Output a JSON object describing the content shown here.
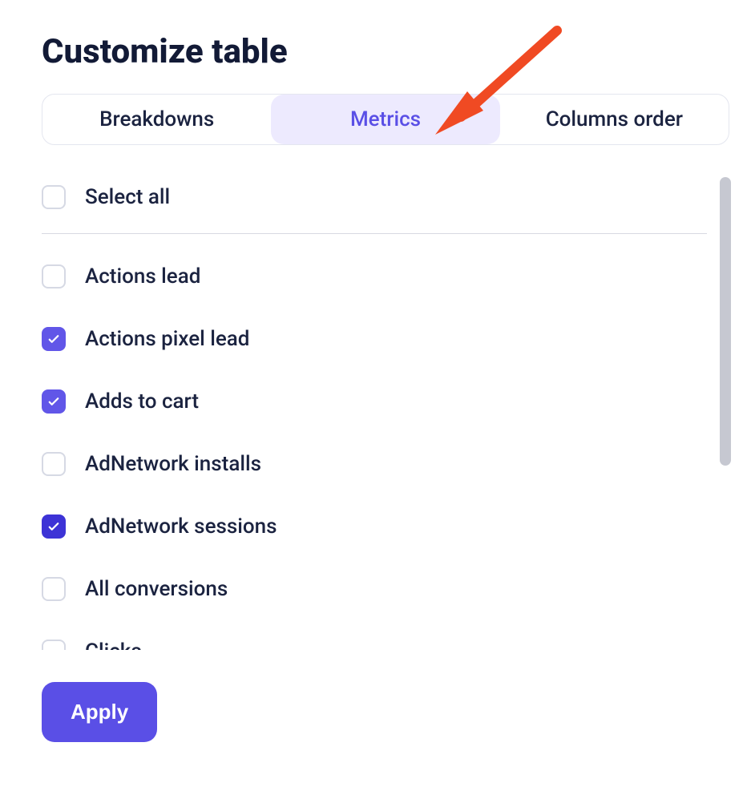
{
  "title": "Customize table",
  "tabs": {
    "breakdowns": "Breakdowns",
    "metrics": "Metrics",
    "columns_order": "Columns order",
    "active": "metrics"
  },
  "select_all": {
    "label": "Select all",
    "checked": false
  },
  "metrics": [
    {
      "label": "Actions lead",
      "checked": false
    },
    {
      "label": "Actions pixel lead",
      "checked": true
    },
    {
      "label": "Adds to cart",
      "checked": true
    },
    {
      "label": "AdNetwork installs",
      "checked": false
    },
    {
      "label": "AdNetwork sessions",
      "checked": true,
      "variant": "dark"
    },
    {
      "label": "All conversions",
      "checked": false
    },
    {
      "label": "Clicks",
      "checked": false
    }
  ],
  "apply_label": "Apply",
  "annotation": {
    "arrow_points_to": "metrics-tab",
    "color": "#f04a23"
  }
}
